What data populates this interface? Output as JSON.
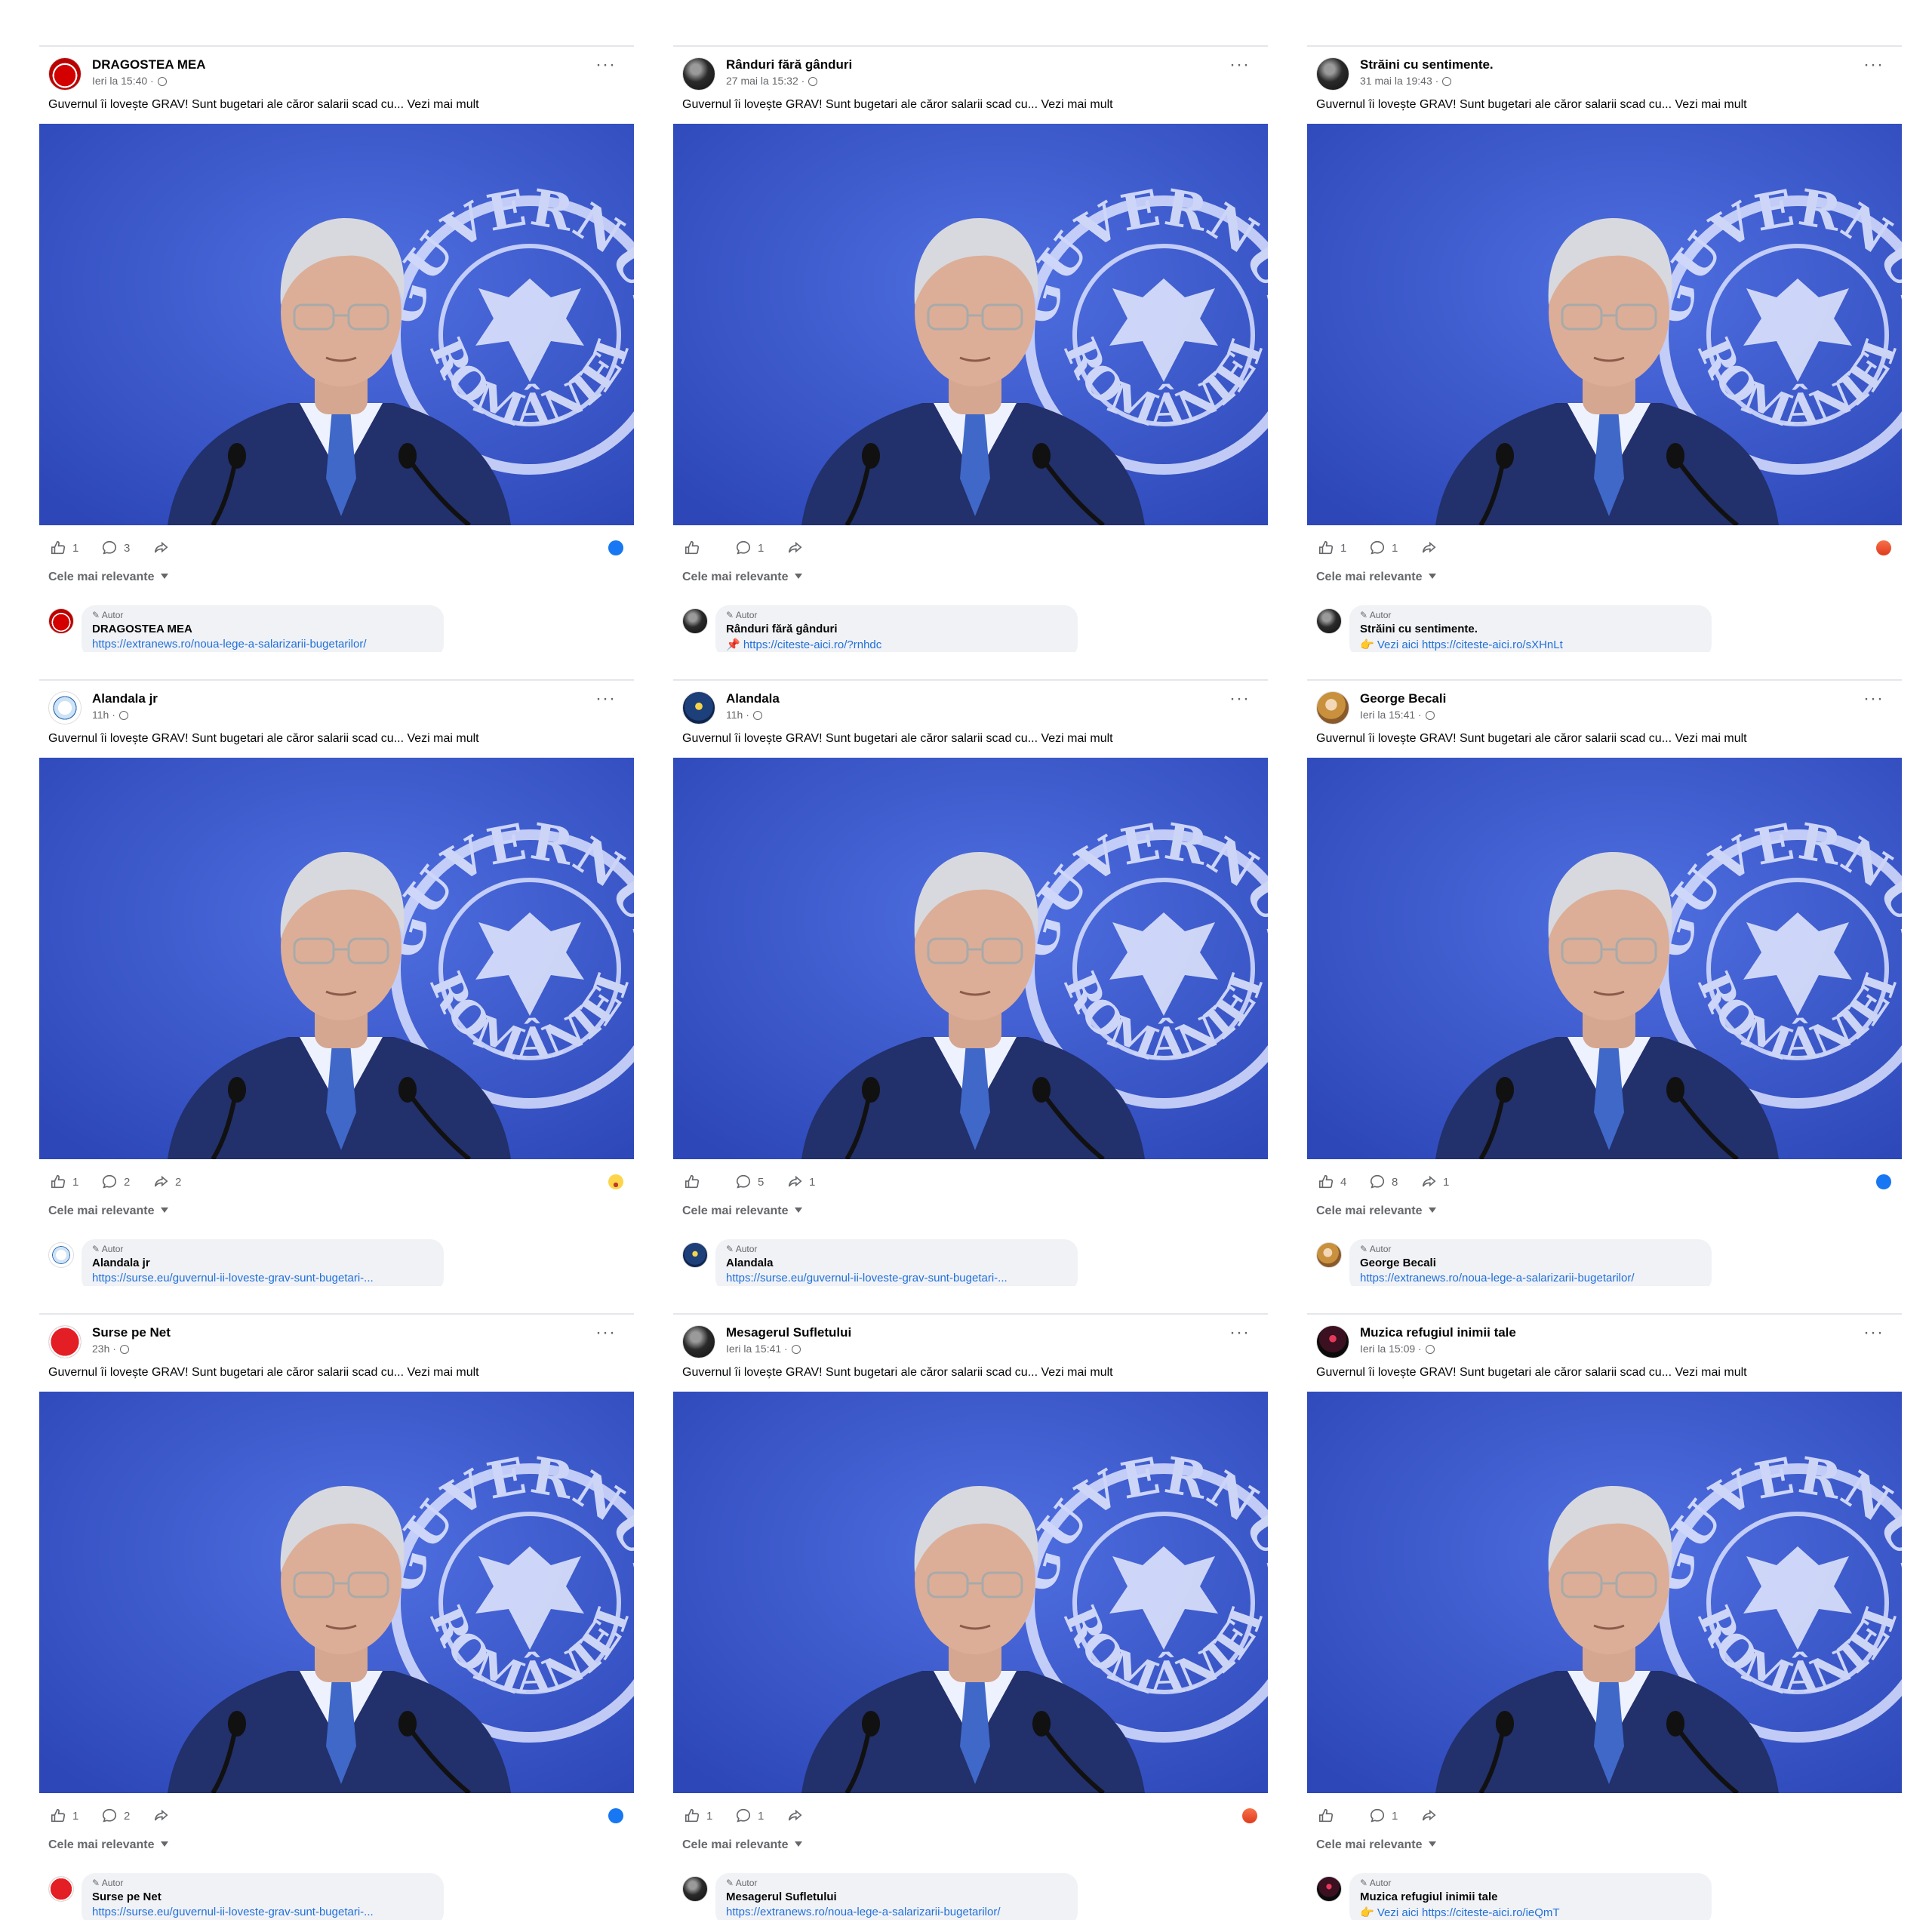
{
  "post_text": "Guvernul îi lovește GRAV! Sunt bugetari ale căror salarii scad cu... Vezi mai mult",
  "sort_label": "Cele mai relevante",
  "author_badge": "✎ Autor",
  "photo_text": {
    "seal_top": "GUVERNUL",
    "seal_bottom": "ROMÂNIEI"
  },
  "colors": {
    "seal_blue": "#3d57c8",
    "link": "#216fdb",
    "like": "#1877f2",
    "muted": "#65676b"
  },
  "posts": [
    {
      "avatar": "av-red",
      "name": "DRAGOSTEA MEA",
      "time": "Ieri la 15:40 ·",
      "likes": "1",
      "comments": "3",
      "shares": "",
      "reaction": "like",
      "comment_link": "https://extranews.ro/noua-lege-a-salarizarii-bugetarilor/"
    },
    {
      "avatar": "av-dark",
      "name": "Rânduri fără gânduri",
      "time": "27 mai la 15:32 ·",
      "likes": "",
      "comments": "1",
      "shares": "",
      "reaction": "",
      "comment_link": "📌 https://citeste-aici.ro/?rnhdc"
    },
    {
      "avatar": "av-dark",
      "name": "Străini cu sentimente.",
      "time": "31 mai la 19:43 ·",
      "likes": "1",
      "comments": "1",
      "shares": "",
      "reaction": "angry",
      "comment_link": "👉 Vezi aici https://citeste-aici.ro/sXHnLt"
    },
    {
      "avatar": "av-light",
      "name": "Alandala jr",
      "time": "11h ·",
      "likes": "1",
      "comments": "2",
      "shares": "2",
      "reaction": "haha",
      "comment_link": "https://surse.eu/guvernul-ii-loveste-grav-sunt-bugetari-..."
    },
    {
      "avatar": "av-blue",
      "name": "Alandala",
      "time": "11h ·",
      "likes": "",
      "comments": "5",
      "shares": "1",
      "reaction": "",
      "comment_link": "https://surse.eu/guvernul-ii-loveste-grav-sunt-bugetari-..."
    },
    {
      "avatar": "av-warm",
      "name": "George Becali",
      "time": "Ieri la 15:41 ·",
      "likes": "4",
      "comments": "8",
      "shares": "1",
      "reaction": "like",
      "comment_link": "https://extranews.ro/noua-lege-a-salarizarii-bugetarilor/"
    },
    {
      "avatar": "av-rednet",
      "name": "Surse pe Net",
      "time": "23h ·",
      "likes": "1",
      "comments": "2",
      "shares": "",
      "reaction": "like",
      "comment_link": "https://surse.eu/guvernul-ii-loveste-grav-sunt-bugetari-..."
    },
    {
      "avatar": "av-dark",
      "name": "Mesagerul Sufletului",
      "time": "Ieri la 15:41 ·",
      "likes": "1",
      "comments": "1",
      "shares": "",
      "reaction": "angry",
      "comment_link": "https://extranews.ro/noua-lege-a-salarizarii-bugetarilor/"
    },
    {
      "avatar": "av-music",
      "name": "Muzica refugiul inimii tale",
      "time": "Ieri la 15:09 ·",
      "likes": "",
      "comments": "1",
      "shares": "",
      "reaction": "",
      "comment_link": "👉 Vezi aici https://citeste-aici.ro/ieQmT"
    }
  ]
}
